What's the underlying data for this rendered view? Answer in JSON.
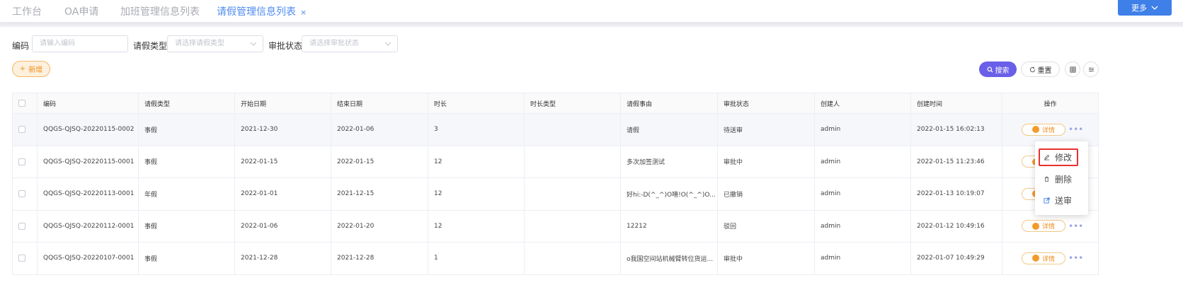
{
  "tabs": [
    {
      "label": "工作台"
    },
    {
      "label": "OA申请"
    },
    {
      "label": "加班管理信息列表"
    },
    {
      "label": "请假管理信息列表",
      "close": "×"
    }
  ],
  "more_label": "更多",
  "filters": {
    "code_label": "编码",
    "code_placeholder": "请输入编码",
    "type_label": "请假类型",
    "type_placeholder": "请选择请假类型",
    "status_label": "审批状态",
    "status_placeholder": "请选择审批状态"
  },
  "toolbar": {
    "add_label": "新增",
    "search_label": "搜索",
    "reset_label": "重置"
  },
  "table": {
    "headers": [
      "编码",
      "请假类型",
      "开始日期",
      "结束日期",
      "时长",
      "时长类型",
      "请假事由",
      "审批状态",
      "创建人",
      "创建时间",
      "操作"
    ],
    "rows": [
      {
        "code": "QQGS-QJSQ-20220115-0002",
        "type": "事假",
        "start": "2021-12-30",
        "end": "2022-01-06",
        "duration": "3",
        "duration_type": "",
        "reason": "请假",
        "status": "待送审",
        "creator": "admin",
        "created": "2022-01-15 16:02:13"
      },
      {
        "code": "QQGS-QJSQ-20220115-0001",
        "type": "事假",
        "start": "2022-01-15",
        "end": "2022-01-15",
        "duration": "12",
        "duration_type": "",
        "reason": "多次加签测试",
        "status": "审批中",
        "creator": "admin",
        "created": "2022-01-15 11:23:46"
      },
      {
        "code": "QQGS-QJSQ-20220113-0001",
        "type": "年假",
        "start": "2022-01-01",
        "end": "2021-12-15",
        "duration": "12",
        "duration_type": "",
        "reason": "好hi:-D(^_^)O嘻!O(^_^)O...",
        "status": "已撤销",
        "creator": "admin",
        "created": "2022-01-13 10:19:07"
      },
      {
        "code": "QQGS-QJSQ-20220112-0001",
        "type": "事假",
        "start": "2022-01-06",
        "end": "2022-01-20",
        "duration": "12",
        "duration_type": "",
        "reason": "12212",
        "status": "驳回",
        "creator": "admin",
        "created": "2022-01-12 10:49:16"
      },
      {
        "code": "QQGS-QJSQ-20220107-0001",
        "type": "事假",
        "start": "2021-12-28",
        "end": "2021-12-28",
        "duration": "1",
        "duration_type": "",
        "reason": "o我国空间站机械臂转位货运...",
        "status": "审批中",
        "creator": "admin",
        "created": "2022-01-07 10:49:29"
      }
    ],
    "detail_label": "详情",
    "more_dots": "•••"
  },
  "dropdown": {
    "items": [
      {
        "label": "修改",
        "icon": "edit-icon"
      },
      {
        "label": "删除",
        "icon": "delete-icon"
      },
      {
        "label": "送审",
        "icon": "submit-icon"
      }
    ]
  },
  "colors": {
    "accent": "#3f7fe8",
    "search": "#6a5fe8",
    "add": "#f08c1e",
    "highlight": "#e8312f"
  }
}
